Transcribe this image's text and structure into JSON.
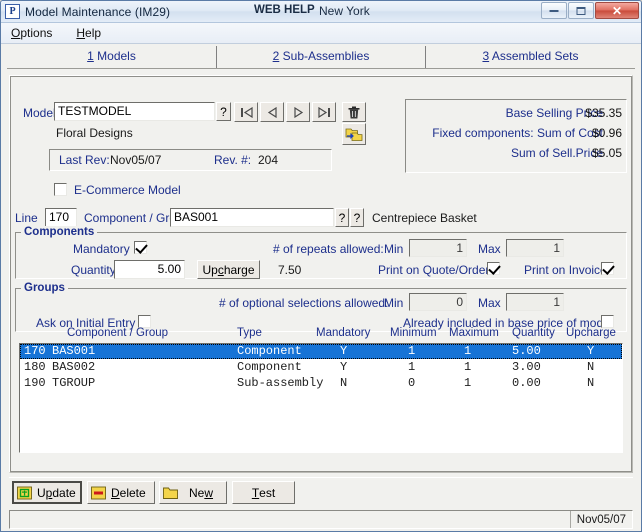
{
  "window": {
    "icon_letter": "P",
    "title": "Model Maintenance (IM29)",
    "web_help": "WEB HELP",
    "location": "New York",
    "minimize_label": "Minimize",
    "maximize_label": "Maximize",
    "close_label": "Close"
  },
  "menu": {
    "items": [
      {
        "accel": "O",
        "rest": "ptions"
      },
      {
        "accel": "H",
        "rest": "elp"
      }
    ]
  },
  "tabs": [
    {
      "num": "1",
      "label": " Models"
    },
    {
      "num": "2",
      "label": " Sub-Assemblies"
    },
    {
      "num": "3",
      "label": " Assembled Sets"
    }
  ],
  "model": {
    "label": "Model",
    "value": "TESTMODEL",
    "lookup_icon": "?",
    "description": "Floral Designs",
    "last_rev_label": "Last Rev:",
    "last_rev_value": "Nov05/07",
    "rev_num_label": "Rev. #:",
    "rev_num_value": "204",
    "ecommerce_label": "E-Commerce Model",
    "ecommerce_checked": false,
    "nav_first": "first-record",
    "nav_prev": "previous-record",
    "nav_next": "next-record",
    "nav_last": "last-record",
    "delete_icon": "trash-icon",
    "copy_icon": "copy-model-icon"
  },
  "prices": {
    "rows": [
      {
        "label": "Base Selling Price",
        "value": "$35.35"
      },
      {
        "label": "Fixed components:  Sum of Cost",
        "value": "$0.96"
      },
      {
        "label": "Sum of Sell.Price",
        "value": "$5.05"
      }
    ]
  },
  "line": {
    "label": "Line",
    "value": "170",
    "component_label": "Component / Group",
    "component_value": "BAS001",
    "lookup1": "?",
    "lookup2": "?",
    "component_description": "Centrepiece Basket"
  },
  "components": {
    "title": "Components",
    "mandatory_label": "Mandatory",
    "mandatory_checked": true,
    "quantity_label": "Quantity",
    "quantity_value": "5.00",
    "upcharge_button": {
      "accel_pre": "Up",
      "accel": "c",
      "accel_post": "harge"
    },
    "upcharge_value": "7.50",
    "repeats_label": "# of repeats allowed:",
    "min_label": "Min",
    "min_value": "1",
    "max_label": "Max",
    "max_value": "1",
    "print_quote_label": "Print on Quote/Order",
    "print_quote_checked": true,
    "print_invoice_label": "Print on Invoice",
    "print_invoice_checked": true
  },
  "groups": {
    "title": "Groups",
    "optional_label": "# of optional selections allowed:",
    "min_label": "Min",
    "min_value": "0",
    "max_label": "Max",
    "max_value": "1",
    "ask_label": "Ask on Initial Entry",
    "ask_checked": false,
    "included_label": "Already included in base price of model",
    "included_checked": false
  },
  "grid": {
    "headers": [
      "Component / Group",
      "Type",
      "Mandatory",
      "Minimum",
      "Maximum",
      "Quantity",
      "Upcharge"
    ],
    "rows": [
      {
        "line": "170",
        "code": "BAS001",
        "type": "Component",
        "mandatory": "Y",
        "minimum": "1",
        "maximum": "1",
        "quantity": "5.00",
        "upcharge": "Y",
        "selected": true
      },
      {
        "line": "180",
        "code": "BAS002",
        "type": "Component",
        "mandatory": "Y",
        "minimum": "1",
        "maximum": "1",
        "quantity": "3.00",
        "upcharge": "N",
        "selected": false
      },
      {
        "line": "190",
        "code": "TGROUP",
        "type": "Sub-assembly",
        "mandatory": "N",
        "minimum": "0",
        "maximum": "1",
        "quantity": "0.00",
        "upcharge": "N",
        "selected": false
      }
    ]
  },
  "actions": [
    {
      "accel_pre": "U",
      "accel": "p",
      "accel_post": "date",
      "icon": "add-icon",
      "default": true
    },
    {
      "accel_pre": "",
      "accel": "D",
      "accel_post": "elete",
      "icon": "remove-icon",
      "default": false
    },
    {
      "accel_pre": "Ne",
      "accel": "w",
      "accel_post": "",
      "icon": "folder-icon",
      "default": false
    },
    {
      "accel_pre": "",
      "accel": "T",
      "accel_post": "est",
      "icon": "none",
      "default": false
    }
  ],
  "status": {
    "date": "Nov05/07"
  },
  "colors": {
    "accent_label": "#1d2f8c",
    "selection": "#1673d6",
    "face": "#f1f1ee",
    "title_gradient_top": "#eef4fb"
  }
}
